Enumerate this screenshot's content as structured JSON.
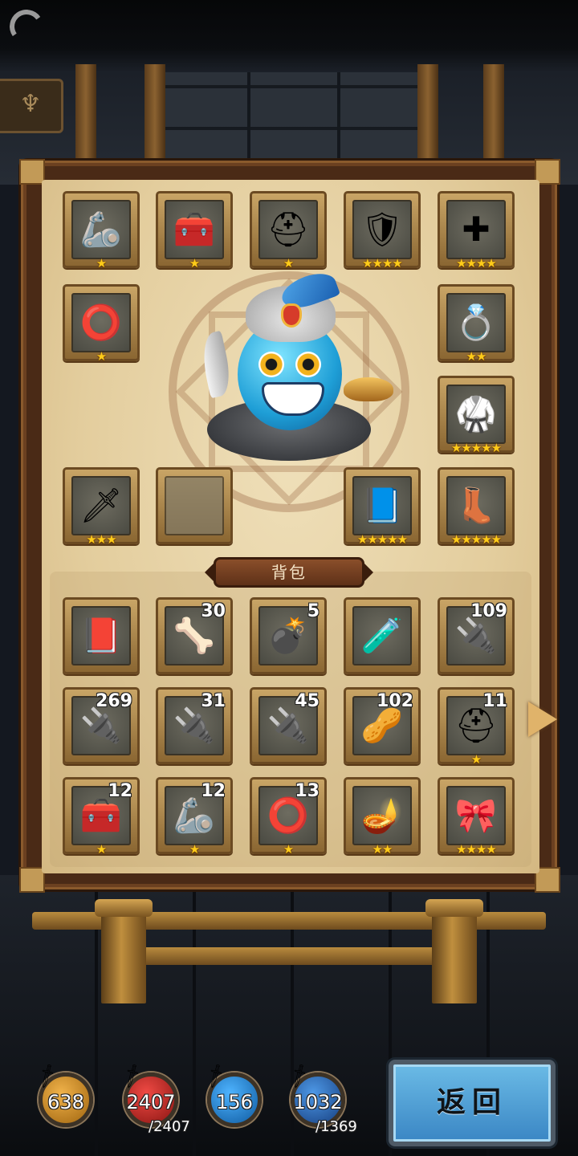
{
  "equipment": [
    {
      "name": "gauntlet",
      "icon": "🦾",
      "stars": "★"
    },
    {
      "name": "chest-armor",
      "icon": "🧰",
      "stars": "★"
    },
    {
      "name": "helmet",
      "icon": "⛑",
      "stars": "★"
    },
    {
      "name": "tech-armor",
      "icon": "🛡",
      "stars": "★★★★"
    },
    {
      "name": "cross-amulet",
      "icon": "✚",
      "stars": "★★★★"
    },
    {
      "name": "bracelet",
      "icon": "⭕",
      "stars": "★"
    },
    {
      "name": "ring",
      "icon": "💍",
      "stars": "★★"
    },
    {
      "name": "green-armor",
      "icon": "🥋",
      "stars": "★★★★★"
    },
    {
      "name": "scimitar",
      "icon": "🗡",
      "stars": "★★★"
    },
    {
      "name": "empty-slot",
      "icon": "",
      "stars": ""
    },
    {
      "name": "crystal-book",
      "icon": "📘",
      "stars": "★★★★★"
    },
    {
      "name": "purple-boots",
      "icon": "👢",
      "stars": "★★★★★"
    }
  ],
  "bag_title": "背包",
  "bag_items": [
    {
      "name": "book",
      "icon": "📕",
      "count": "",
      "stars": ""
    },
    {
      "name": "silver-bone",
      "icon": "🦴",
      "count": "30",
      "stars": ""
    },
    {
      "name": "black-bomb",
      "icon": "💣",
      "count": "5",
      "stars": ""
    },
    {
      "name": "red-potion",
      "icon": "🧪",
      "count": "",
      "stars": ""
    },
    {
      "name": "chip-red",
      "icon": "🔌",
      "count": "109",
      "stars": ""
    },
    {
      "name": "chip-green",
      "icon": "🔌",
      "count": "269",
      "stars": ""
    },
    {
      "name": "chip-grey",
      "icon": "🔌",
      "count": "31",
      "stars": ""
    },
    {
      "name": "chip-yellow",
      "icon": "🔌",
      "count": "45",
      "stars": ""
    },
    {
      "name": "bullet",
      "icon": "🥜",
      "count": "102",
      "stars": ""
    },
    {
      "name": "helmet",
      "icon": "⛑",
      "count": "11",
      "stars": "★"
    },
    {
      "name": "chest-armor",
      "icon": "🧰",
      "count": "12",
      "stars": "★"
    },
    {
      "name": "gauntlet",
      "icon": "🦾",
      "count": "12",
      "stars": "★"
    },
    {
      "name": "bracelet",
      "icon": "⭕",
      "count": "13",
      "stars": "★"
    },
    {
      "name": "magic-lamp",
      "icon": "🪔",
      "count": "",
      "stars": "★★"
    },
    {
      "name": "belt",
      "icon": "🎀",
      "count": "",
      "stars": "★★★★"
    }
  ],
  "stats": {
    "attack": {
      "value": "638",
      "icon": "sword-icon",
      "color": "#c8861e"
    },
    "hp": {
      "value": "2407",
      "max": "/2407",
      "icon": "sword-icon",
      "color": "#c02a28"
    },
    "defense": {
      "value": "156",
      "icon": "sword-icon",
      "color": "#1f7fd0"
    },
    "energy": {
      "value": "1032",
      "max": "/1369",
      "icon": "sword-icon",
      "color": "#2e70b8"
    }
  },
  "back_button": "返回"
}
